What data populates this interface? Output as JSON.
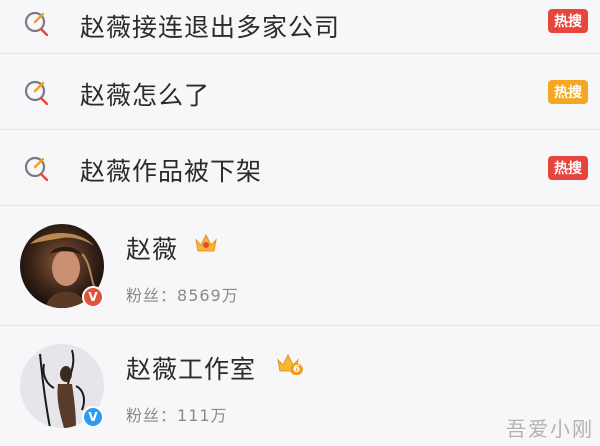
{
  "search_results": [
    {
      "query": "赵薇接连退出多家公司",
      "badge": "热搜",
      "badge_color": "#e8453c"
    },
    {
      "query": "赵薇怎么了",
      "badge": "热搜",
      "badge_color": "#f5a623"
    },
    {
      "query": "赵薇作品被下架",
      "badge": "热搜",
      "badge_color": "#e8453c"
    }
  ],
  "users": [
    {
      "name": "赵薇",
      "fans_label": "粉丝：",
      "fans": "8569万",
      "verify_color": "#e0533a",
      "crown_level": ""
    },
    {
      "name": "赵薇工作室",
      "fans_label": "粉丝：",
      "fans": "111万",
      "verify_color": "#2d9cf0",
      "crown_level": "6"
    }
  ],
  "watermark": "吾爱小刚"
}
